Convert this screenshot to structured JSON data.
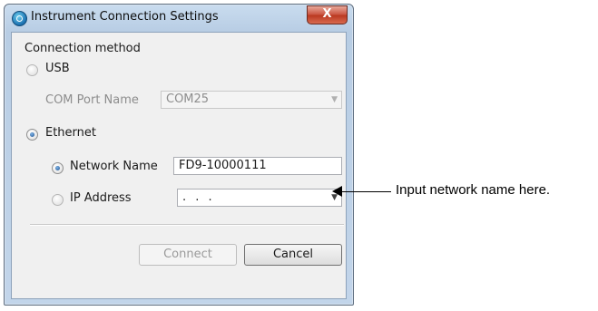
{
  "window": {
    "title": "Instrument Connection Settings",
    "close_symbol": "X",
    "icon": "app-icon"
  },
  "connection": {
    "group_label": "Connection method",
    "usb": {
      "label": "USB",
      "selected": false,
      "com_port_label": "COM Port Name",
      "com_port_value": "COM25",
      "enabled": false
    },
    "ethernet": {
      "label": "Ethernet",
      "selected": true,
      "network_name_label": "Network Name",
      "network_name_value": "FD9-10000111",
      "network_name_selected": true,
      "ip_address_label": "IP Address",
      "ip_address_value": " .  .  .",
      "ip_address_selected": false
    }
  },
  "buttons": {
    "connect": "Connect",
    "cancel": "Cancel"
  },
  "annotation": {
    "text": "Input network name here."
  },
  "colors": {
    "titlebar": "#b8cde4",
    "close_button": "#c9513c",
    "dialog_background": "#f0f0f0"
  }
}
